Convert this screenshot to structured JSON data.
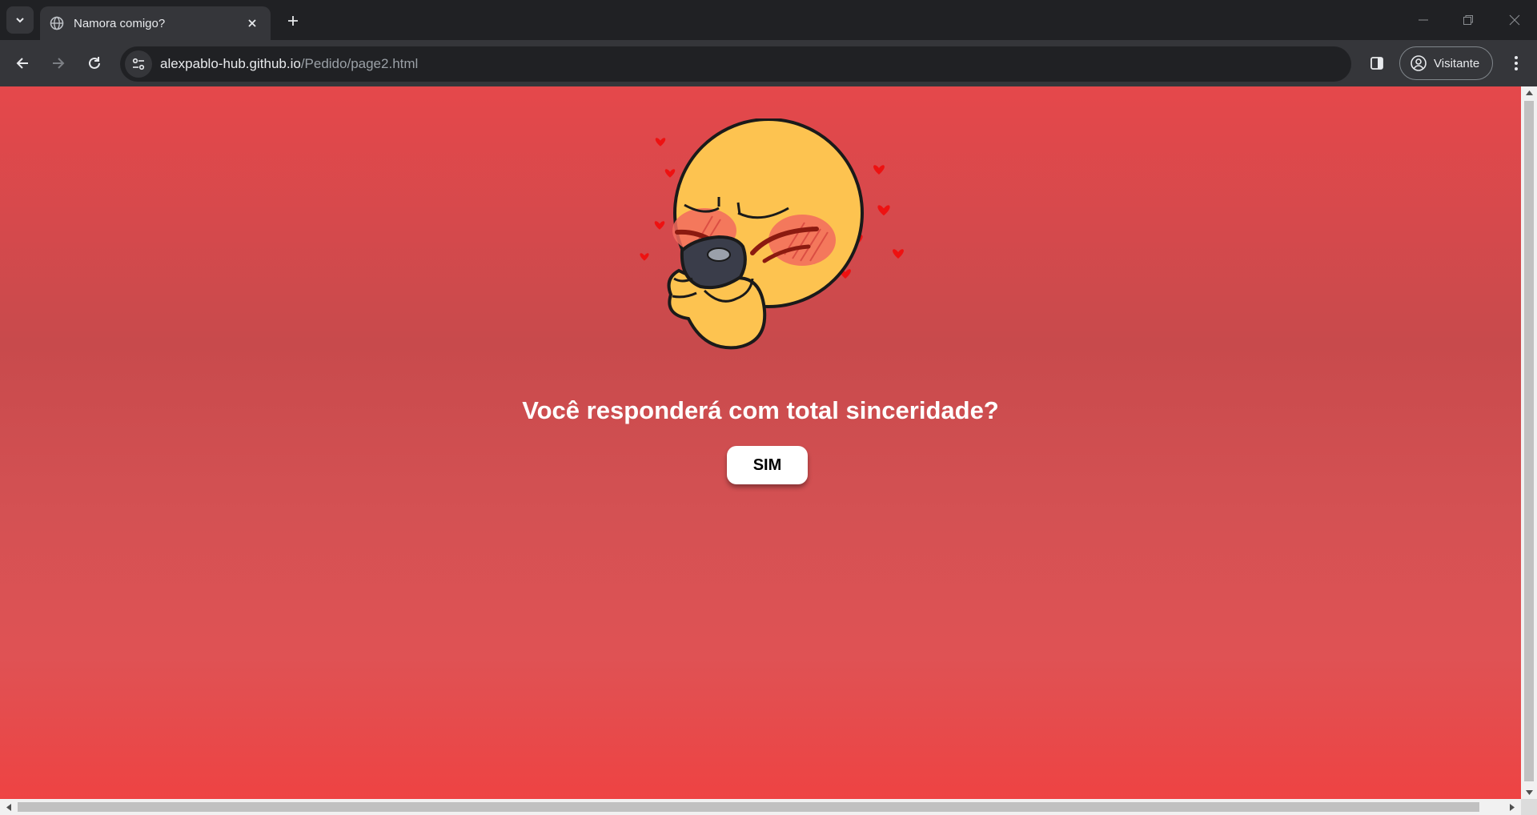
{
  "browser": {
    "tab": {
      "title": "Namora comigo?",
      "favicon": "globe-icon"
    },
    "address": {
      "host": "alexpablo-hub.github.io",
      "path": "/Pedido/page2.html"
    },
    "profile_label": "Visitante"
  },
  "page": {
    "question": "Você responderá com total sinceridade?",
    "button_label": "SIM",
    "image": "blushing-emoji-phone-hearts",
    "colors": {
      "bg_top": "#e5484b",
      "bg_mid": "#c84a4c",
      "bg_bottom": "#ee4343",
      "text": "#ffffff",
      "button_bg": "#ffffff"
    }
  }
}
